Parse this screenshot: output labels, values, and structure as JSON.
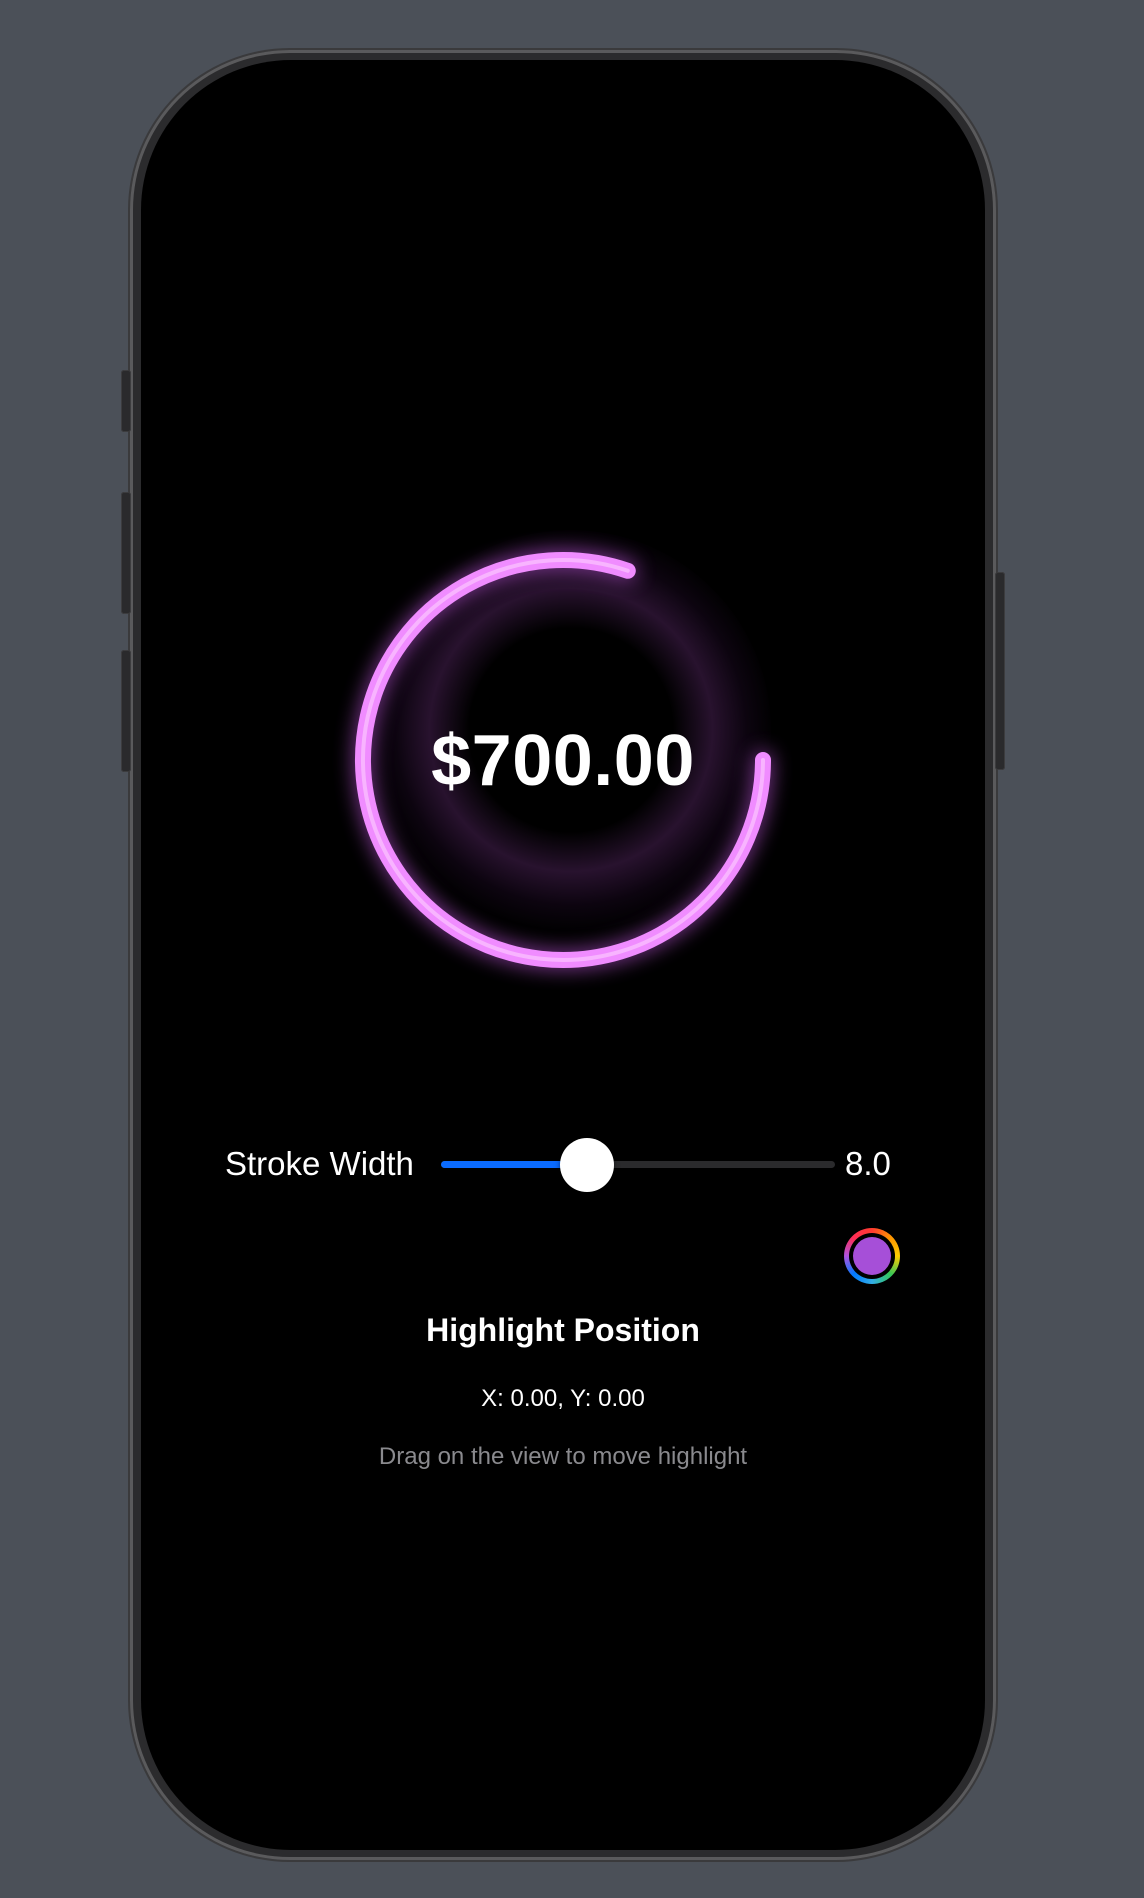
{
  "gauge": {
    "amount": "$700.00",
    "progress": 0.75,
    "ring_color": "#f08cff",
    "glow_color": "#c85ae6"
  },
  "stroke_control": {
    "label": "Stroke Width",
    "value_text": "8.0",
    "slider_fraction": 0.35,
    "fill_color": "#0a6bff"
  },
  "color_picker": {
    "icon": "color-well-icon",
    "selected_color": "#a64fd8"
  },
  "highlight": {
    "title": "Highlight Position",
    "coords": "X: 0.00, Y: 0.00",
    "hint": "Drag on the view to move highlight"
  }
}
